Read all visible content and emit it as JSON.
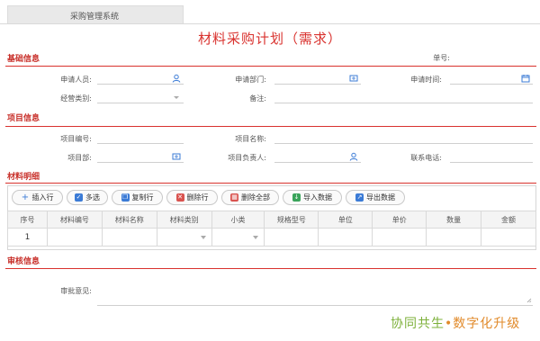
{
  "tab": {
    "label": "采购管理系统"
  },
  "title": "材料采购计划（需求）",
  "sections": {
    "basic": "基础信息",
    "project": "项目信息",
    "materials": "材料明细",
    "review": "审核信息"
  },
  "basic": {
    "order_no_label": "单号:",
    "applicant_label": "申请人员:",
    "dept_label": "申请部门:",
    "time_label": "申请时间:",
    "biz_type_label": "经营类别:",
    "remark_label": "备注:"
  },
  "project": {
    "code_label": "项目编号:",
    "name_label": "项目名称:",
    "dept_label": "项目部:",
    "manager_label": "项目负责人:",
    "phone_label": "联系电话:"
  },
  "toolbar": {
    "insert": "插入行",
    "multi": "多选",
    "copy": "复制行",
    "delete": "删除行",
    "delete_all": "删除全部",
    "import": "导入数据",
    "export": "导出数据"
  },
  "table": {
    "headers": [
      "序号",
      "材料编号",
      "材料名称",
      "材料类别",
      "小类",
      "规格型号",
      "单位",
      "单价",
      "数量",
      "金额"
    ],
    "rows": [
      {
        "seq": "1"
      }
    ]
  },
  "review": {
    "opinion_label": "审批意见:"
  },
  "brand": {
    "part1": "协同共生",
    "dot": "•",
    "part2": "数字化升级"
  },
  "colors": {
    "accent": "#d9322e",
    "brand_green": "#7db03a",
    "brand_orange": "#e18a2a"
  }
}
